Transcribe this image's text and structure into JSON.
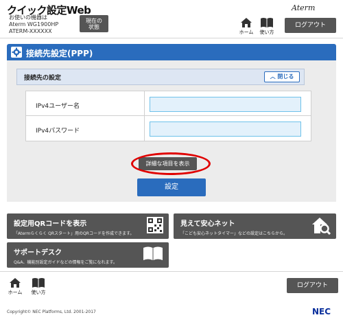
{
  "header": {
    "app_title": "クイック設定Web",
    "device_lines": [
      "お使いの機器は",
      "Aterm WG1900HP",
      "ATERM-XXXXXX"
    ],
    "status_button": [
      "現在の",
      "状態"
    ],
    "brand": "Aterm",
    "home_label": "ホーム",
    "manual_label": "使い方",
    "logout_label": "ログアウト"
  },
  "section": {
    "title": "接続先設定(PPP)",
    "subsection_title": "接続先の設定",
    "collapse_label": "閉じる",
    "fields": [
      {
        "label": "IPv4ユーザー名",
        "value": ""
      },
      {
        "label": "IPv4パスワード",
        "value": ""
      }
    ],
    "detail_button_label": "詳細な項目を表示",
    "settings_button_label": "設定"
  },
  "panels": {
    "qr": {
      "title": "設定用QRコードを表示",
      "desc": "「Atermらくらく QRスタート」用のQRコードを作成できます。"
    },
    "safety": {
      "title": "見えて安心ネット",
      "desc": "「こども安心ネットタイマー」などの設定はこちらから。"
    },
    "support": {
      "title": "サポートデスク",
      "desc": "Q&A、機能別設定ガイドなどの情報をご覧になれます。"
    }
  },
  "footer": {
    "home_label": "ホーム",
    "manual_label": "使い方",
    "logout_label": "ログアウト",
    "copyright": "Copyright© NEC Platforms, Ltd. 2001-2017",
    "brand": "NEC"
  },
  "colors": {
    "primary_blue": "#2a6cbd",
    "dark_button": "#555555",
    "input_bg": "#e3f1fb",
    "highlight_red": "#e00000"
  }
}
